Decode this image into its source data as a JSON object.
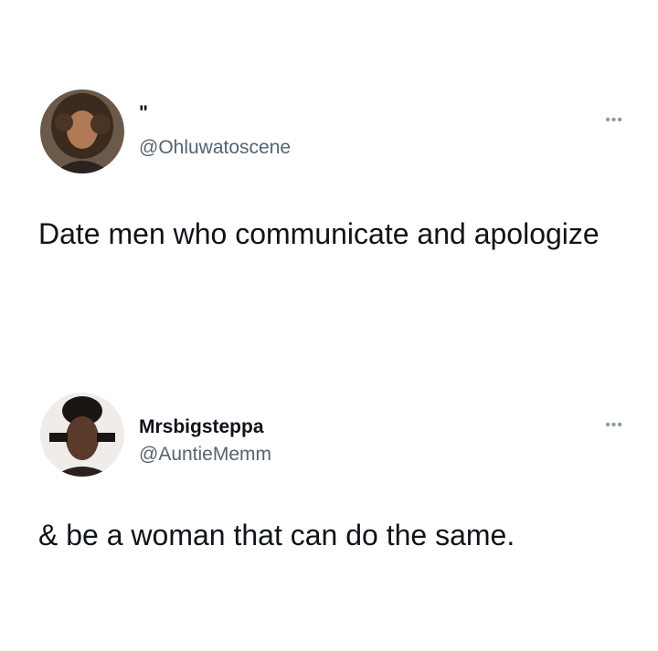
{
  "tweets": [
    {
      "display_name": "\"",
      "handle": "@Ohluwatoscene",
      "text": "Date men who communicate and apologize",
      "more_icon": "more-horizontal-icon"
    },
    {
      "display_name": "Mrsbigsteppa",
      "handle": "@AuntieMemm",
      "text": "& be a woman that can do the same.",
      "more_icon": "more-horizontal-icon"
    }
  ],
  "more_glyph": "•••"
}
